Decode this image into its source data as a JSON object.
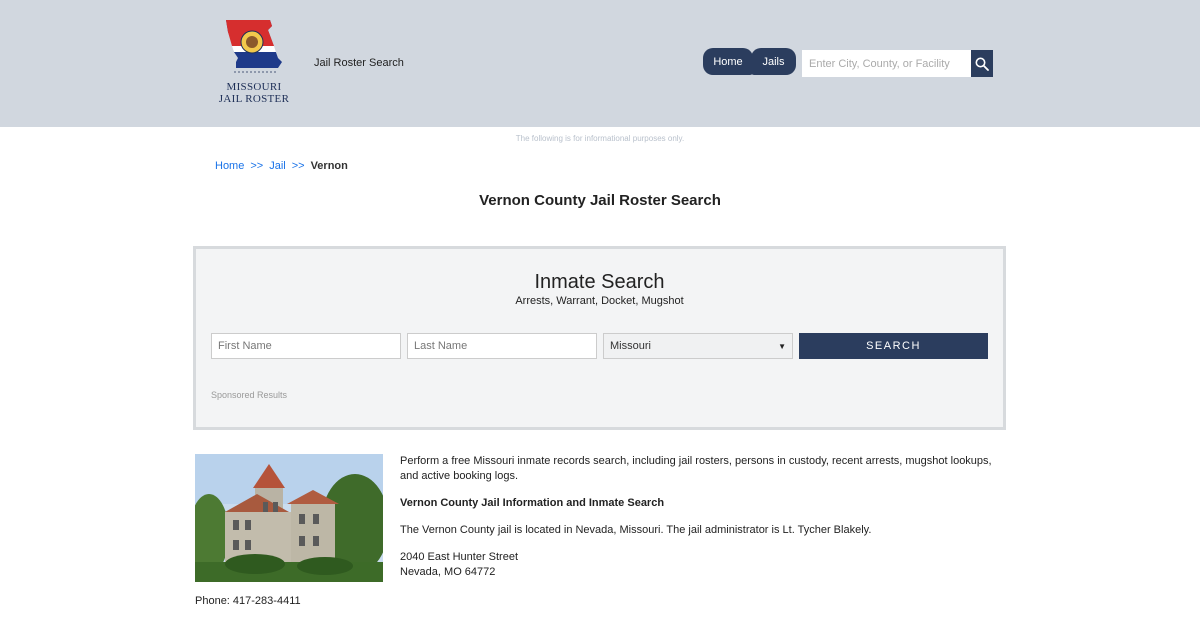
{
  "header": {
    "logo_line1": "MISSOURI",
    "logo_line2": "JAIL ROSTER",
    "site_name": "Jail Roster Search",
    "nav": {
      "home": "Home",
      "jails": "Jails"
    },
    "search_placeholder": "Enter City, County, or Facility"
  },
  "disclaimer": "The following is for informational purposes only.",
  "breadcrumb": {
    "home": "Home",
    "sep": ">>",
    "jail": "Jail",
    "current": "Vernon"
  },
  "page_title": "Vernon County Jail Roster Search",
  "inmate_search": {
    "title": "Inmate Search",
    "subtitle": "Arrests, Warrant, Docket, Mugshot",
    "first_name_placeholder": "First Name",
    "last_name_placeholder": "Last Name",
    "state_selected": "Missouri",
    "button": "SEARCH",
    "sponsored": "Sponsored Results"
  },
  "info": {
    "intro": "Perform a free Missouri inmate records search, including jail rosters, persons in custody, recent arrests, mugshot lookups, and active booking logs.",
    "heading": "Vernon County Jail Information and Inmate Search",
    "location": "The Vernon County jail is located in Nevada, Missouri. The jail administrator is Lt. Tycher Blakely.",
    "address_line1": "2040 East Hunter Street",
    "address_line2": "Nevada, MO 64772",
    "phone": "Phone: 417-283-4411"
  },
  "colors": {
    "header_bg": "#d1d7df",
    "accent": "#2b3d5e",
    "link": "#1a73e8"
  },
  "icons": {
    "search": "search-icon",
    "chevron": "chevron-down-icon"
  }
}
